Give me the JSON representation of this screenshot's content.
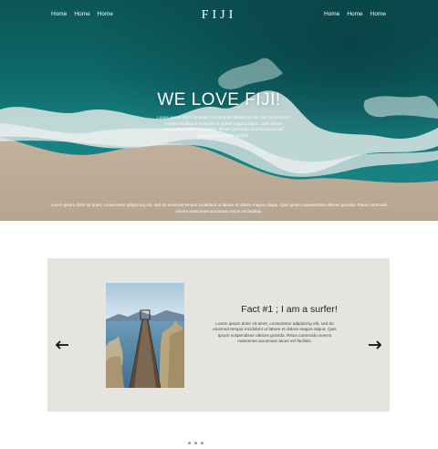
{
  "nav": {
    "left": [
      "Home",
      "Home",
      "Home"
    ],
    "right": [
      "Home",
      "Home",
      "Home"
    ],
    "brand": "FIJI"
  },
  "hero": {
    "title": "WE LOVE FIJI!",
    "subtitle": "Lorem ipsum dolor sit amet, consectetur adipiscing elit, sed do eiusmod tempor incididunt ut labore et dolore magna aliqua. Quis ipsum suspendisse ultrices gravida. Risus commodo viverra maecenas accumsan lacus vel facilisis.",
    "footer_text": "Lorem ipsum dolor sit amet, consectetur adipiscing elit, sed do eiusmod tempor incididunt ut labore et dolore magna aliqua. Quis ipsum suspendisse ultrices gravida. Risus commodo viverra maecenas accumsan lacus vel facilisis."
  },
  "slider": {
    "title": "Fact #1 ; I am a surfer!",
    "text": "Lorem ipsum dolor sit amet, consectetur adipiscing elit, sed do eiusmod tempor incididunt ut labore et dolore magna aliqua. Quis ipsum suspendisse ultrices gravida. Risus commodo viverra maecenas accumsan lacus vel facilisis.",
    "prev_icon": "arrow-left-icon",
    "next_icon": "arrow-right-icon"
  },
  "colors": {
    "slider_bg": "#e5e4e1",
    "ocean": "#0f6a6e",
    "sand": "#d9c9b4"
  }
}
